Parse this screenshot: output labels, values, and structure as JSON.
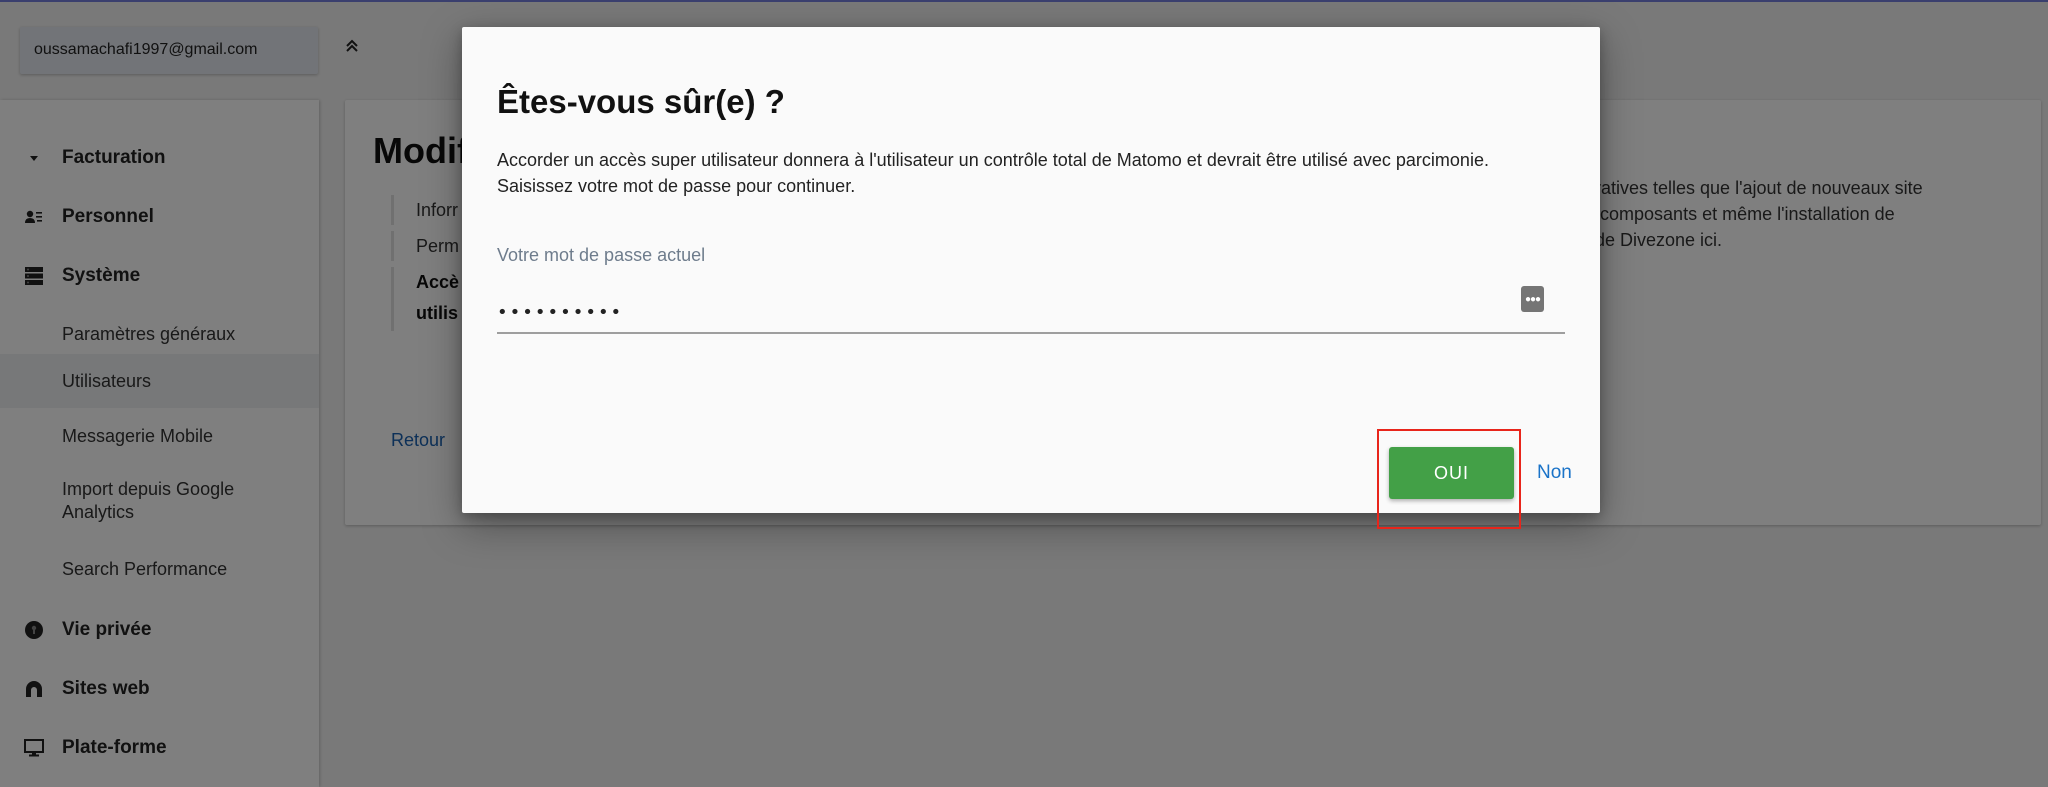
{
  "header": {
    "user_email": "oussamachafi1997@gmail.com",
    "collapse_icon": "double-chevron-up-icon"
  },
  "sidebar": {
    "items": [
      {
        "label": "Facturation",
        "type": "section",
        "icon": "caret-down-icon"
      },
      {
        "label": "Personnel",
        "type": "section",
        "icon": "user-list-icon"
      },
      {
        "label": "Système",
        "type": "section",
        "icon": "server-icon"
      },
      {
        "label": "Paramètres généraux",
        "type": "sub"
      },
      {
        "label": "Utilisateurs",
        "type": "sub",
        "active": true
      },
      {
        "label": "Messagerie Mobile",
        "type": "sub"
      },
      {
        "label": "Import depuis Google Analytics",
        "type": "sub"
      },
      {
        "label": "Search Performance",
        "type": "sub"
      },
      {
        "label": "Vie privée",
        "type": "section",
        "icon": "keyhole-icon"
      },
      {
        "label": "Sites web",
        "type": "section",
        "icon": "half-circle-icon"
      },
      {
        "label": "Plate-forme",
        "type": "section",
        "icon": "monitor-icon"
      }
    ]
  },
  "content": {
    "title": "Modifi",
    "tabs": [
      {
        "label": "Inforr"
      },
      {
        "label": "Perm"
      },
      {
        "label_line1": "Accè",
        "label_line2": "utilis"
      }
    ],
    "back_label": "Retour",
    "description_lines": [
      "strratives telles que l'ajout de nouveaux site",
      "de composants et même l'installation de",
      "rs de Divezone ici."
    ]
  },
  "modal": {
    "title": "Êtes-vous sûr(e) ?",
    "text": "Accorder un accès super utilisateur donnera à l'utilisateur un contrôle total de Matomo et devrait être utilisé avec parcimonie. Saisissez votre mot de passe pour continuer.",
    "password_label": "Votre mot de passe actuel",
    "password_value": "••••••••••",
    "password_manager_icon": "password-manager-icon",
    "confirm_label": "OUI",
    "cancel_label": "Non",
    "confirm_color": "#43a047",
    "cancel_color": "#1a73c8"
  },
  "annotation": {
    "highlight_color": "#e8251b",
    "target": "confirm-button"
  }
}
